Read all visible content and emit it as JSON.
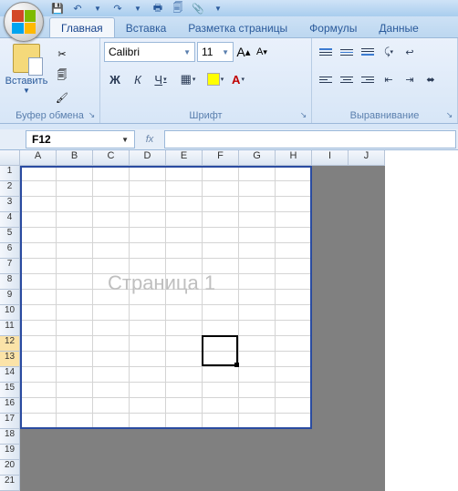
{
  "qat": {
    "save_icon": "💾",
    "undo_icon": "↶",
    "redo_icon": "↷",
    "print_icon": "🖶",
    "preview_icon": "🗐",
    "attach_icon": "📎"
  },
  "tabs": {
    "home": "Главная",
    "insert": "Вставка",
    "layout": "Разметка страницы",
    "formulas": "Формулы",
    "data": "Данные"
  },
  "ribbon": {
    "clipboard": {
      "paste": "Вставить",
      "group_label": "Буфер обмена"
    },
    "font": {
      "name": "Calibri",
      "size": "11",
      "group_label": "Шрифт",
      "bold": "Ж",
      "italic": "К",
      "underline": "Ч"
    },
    "alignment": {
      "group_label": "Выравнивание"
    }
  },
  "formula_bar": {
    "cell_ref": "F12",
    "fx_label": "fx",
    "value": ""
  },
  "sheet": {
    "columns": [
      "A",
      "B",
      "C",
      "D",
      "E",
      "F",
      "G",
      "H",
      "I",
      "J"
    ],
    "rows": [
      "1",
      "2",
      "3",
      "4",
      "5",
      "6",
      "7",
      "8",
      "9",
      "10",
      "11",
      "12",
      "13",
      "14",
      "15",
      "16",
      "17",
      "18",
      "19",
      "20",
      "21"
    ],
    "watermark": "Страница 1",
    "active_cell": "F12",
    "print_area_cols": 8,
    "print_area_rows": 17
  }
}
